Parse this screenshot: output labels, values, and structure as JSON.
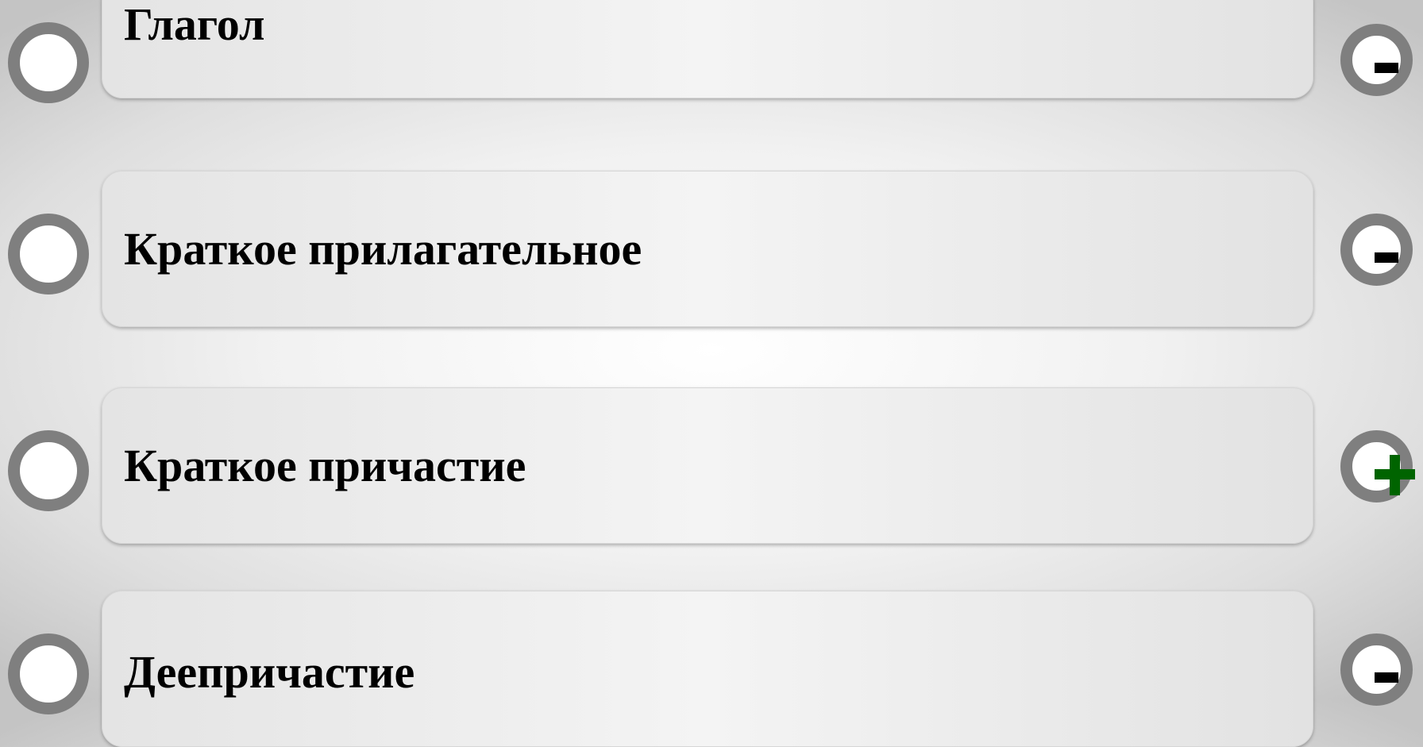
{
  "answers": [
    {
      "label": "Глагол",
      "mark": "minus"
    },
    {
      "label": "Краткое прилагательное",
      "mark": "minus"
    },
    {
      "label": "Краткое причастие",
      "mark": "plus"
    },
    {
      "label": "Деепричастие",
      "mark": "minus"
    }
  ],
  "icons": {
    "radio": "radio-button-icon",
    "minus": "minus-icon",
    "plus": "plus-icon"
  },
  "colors": {
    "ring": "#7f7f7f",
    "plus": "#006400",
    "minus": "#000000",
    "text": "#000000"
  }
}
